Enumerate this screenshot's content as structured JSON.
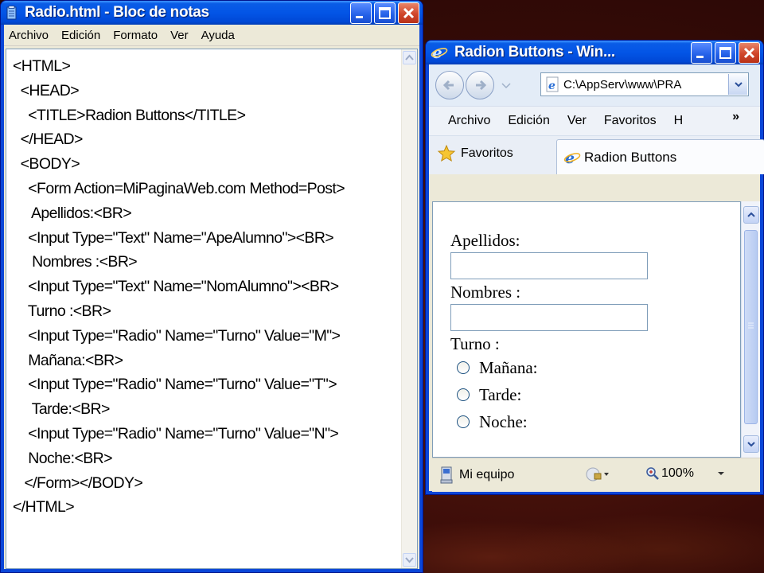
{
  "notepad": {
    "title": "Radio.html - Bloc de notas",
    "menu": [
      "Archivo",
      "Edición",
      "Formato",
      "Ver",
      "Ayuda"
    ],
    "content_lines": [
      "<HTML>",
      "  <HEAD>",
      "    <TITLE>Radion Buttons</TITLE>",
      "  </HEAD>",
      "  <BODY>",
      "    <Form Action=MiPaginaWeb.com Method=Post>",
      "     Apellidos:<BR>",
      "    <Input Type=\"Text\" Name=\"ApeAlumno\"><BR>",
      "     Nombres :<BR>",
      "    <Input Type=\"Text\" Name=\"NomAlumno\"><BR>",
      "    Turno :<BR>",
      "    <Input Type=\"Radio\" Name=\"Turno\" Value=\"M\">",
      "    Mañana:<BR>",
      "    <Input Type=\"Radio\" Name=\"Turno\" Value=\"T\">",
      "     Tarde:<BR>",
      "    <Input Type=\"Radio\" Name=\"Turno\" Value=\"N\">",
      "    Noche:<BR>",
      "   </Form></BODY>",
      "</HTML>"
    ]
  },
  "ie": {
    "title": "Radion Buttons - Win...",
    "address": "C:\\AppServ\\www\\PRA",
    "menu": [
      "Archivo",
      "Edición",
      "Ver",
      "Favoritos",
      "H"
    ],
    "menu_more": "»",
    "favorites_label": "Favoritos",
    "tab_label": "Radion Buttons",
    "page": {
      "apellidos_label": "Apellidos:",
      "nombres_label": "Nombres :",
      "turno_label": "Turno :",
      "radios": [
        "Mañana:",
        "Tarde:",
        "Noche:"
      ]
    },
    "status": {
      "zone": "Mi equipo",
      "zoom": "100%"
    }
  }
}
